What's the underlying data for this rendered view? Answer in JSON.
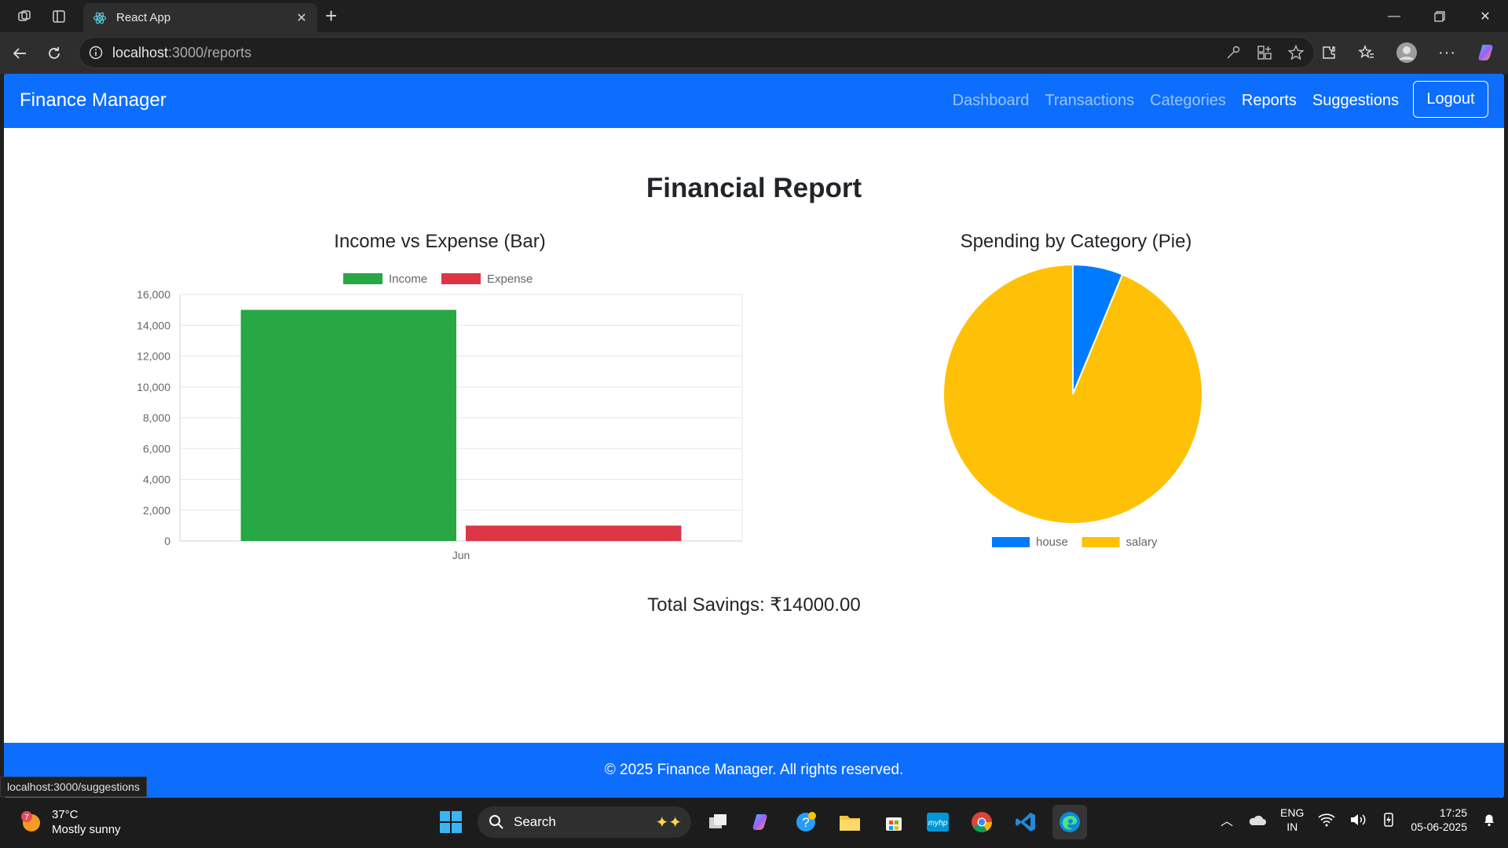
{
  "browser": {
    "tab_title": "React App",
    "url_host": "localhost",
    "url_rest": ":3000/reports",
    "status_link": "localhost:3000/suggestions"
  },
  "app": {
    "brand": "Finance Manager",
    "nav": [
      {
        "label": "Dashboard",
        "active": false
      },
      {
        "label": "Transactions",
        "active": false
      },
      {
        "label": "Categories",
        "active": false
      },
      {
        "label": "Reports",
        "active": true
      },
      {
        "label": "Suggestions",
        "active": true
      }
    ],
    "logout_label": "Logout",
    "page_title": "Financial Report",
    "bar_title": "Income vs Expense (Bar)",
    "pie_title": "Spending by Category (Pie)",
    "savings_text": "Total Savings: ₹14000.00",
    "footer_text": "© 2025 Finance Manager. All rights reserved."
  },
  "chart_data": [
    {
      "type": "bar",
      "categories": [
        "Jun"
      ],
      "series": [
        {
          "name": "Income",
          "color": "#28a745",
          "values": [
            15000
          ]
        },
        {
          "name": "Expense",
          "color": "#dc3545",
          "values": [
            1000
          ]
        }
      ],
      "ylim": [
        0,
        16000
      ],
      "yticks": [
        "0",
        "2,000",
        "4,000",
        "6,000",
        "8,000",
        "10,000",
        "12,000",
        "14,000",
        "16,000"
      ],
      "legend": "top",
      "grid": true
    },
    {
      "type": "pie",
      "labels": [
        "house",
        "salary"
      ],
      "values": [
        1000,
        15000
      ],
      "colors": [
        "#007bff",
        "#ffc107"
      ],
      "legend": "bottom"
    }
  ],
  "taskbar": {
    "temperature": "37°C",
    "weather": "Mostly sunny",
    "weather_badge": "7",
    "search_label": "Search",
    "lang_line1": "ENG",
    "lang_line2": "IN",
    "time": "17:25",
    "date": "05-06-2025"
  }
}
